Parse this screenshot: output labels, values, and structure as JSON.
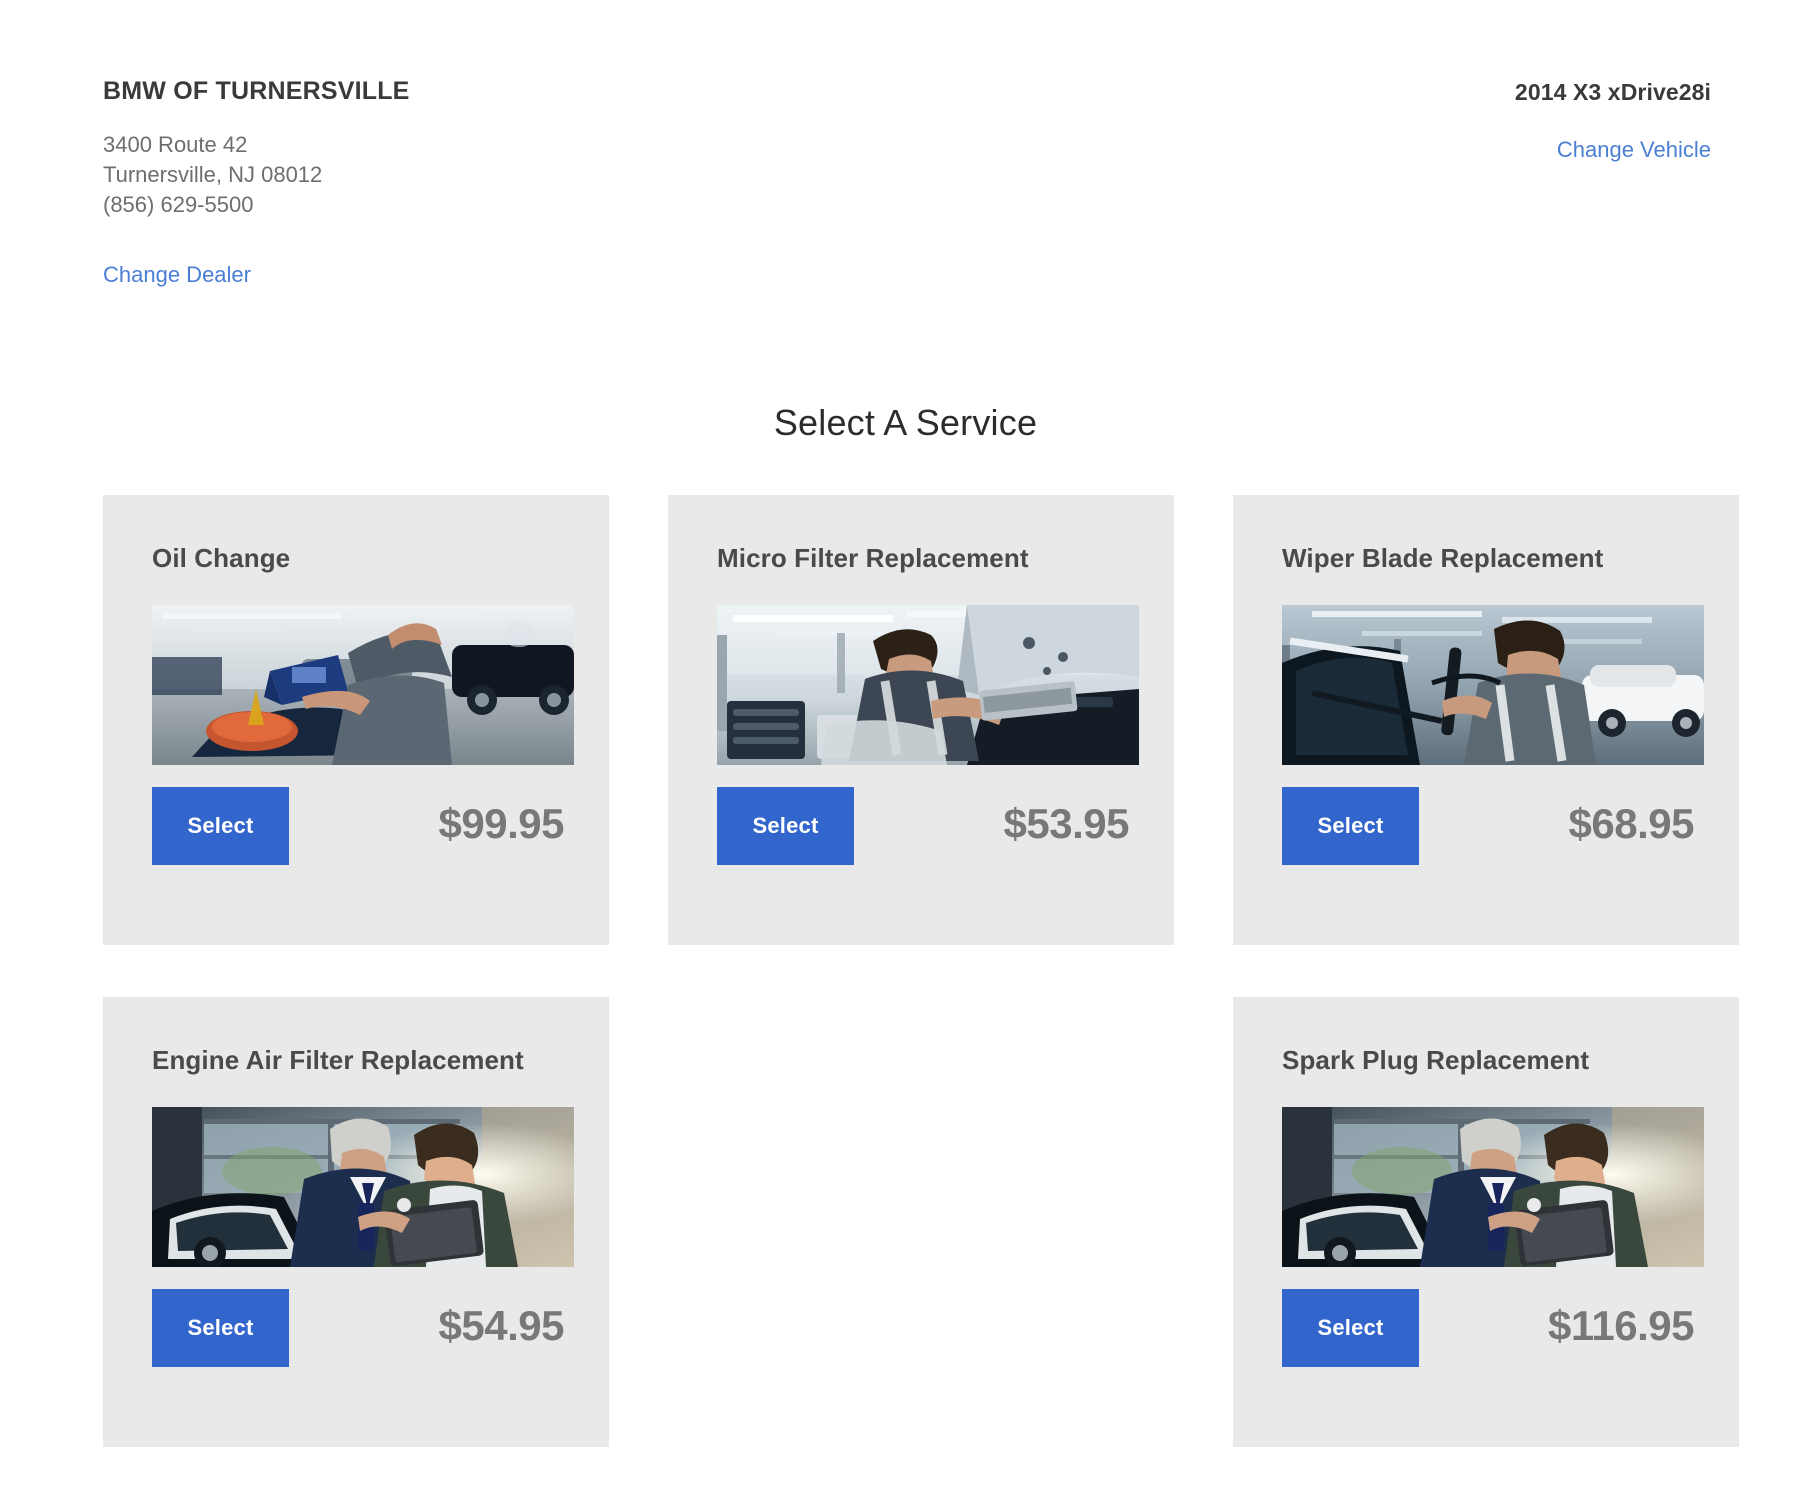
{
  "header": {
    "dealer": {
      "name": "BMW OF TURNERSVILLE",
      "address_line1": "3400 Route 42",
      "address_line2": "Turnersville, NJ 08012",
      "phone": "(856) 629-5500",
      "change_dealer_label": "Change Dealer"
    },
    "vehicle": {
      "name": "2014 X3 xDrive28i",
      "change_vehicle_label": "Change Vehicle"
    }
  },
  "main": {
    "title": "Select A Service",
    "services": [
      {
        "name": "Oil Change",
        "price": "$99.95",
        "select_label": "Select",
        "image_alt": "technician pouring engine oil into funnel",
        "image_id": "oil-change-photo"
      },
      {
        "name": "Micro Filter Replacement",
        "price": "$53.95",
        "select_label": "Select",
        "image_alt": "technician installing cabin micro filter under hood",
        "image_id": "micro-filter-photo"
      },
      {
        "name": "Wiper Blade Replacement",
        "price": "$68.95",
        "select_label": "Select",
        "image_alt": "technician replacing windshield wiper blade",
        "image_id": "wiper-blade-photo"
      },
      {
        "name": "Engine Air Filter Replacement",
        "price": "$54.95",
        "select_label": "Select",
        "image_alt": "service advisor showing tablet to customer in showroom",
        "image_id": "engine-air-filter-photo"
      },
      {
        "name": "Spark Plug Replacement",
        "price": "$116.95",
        "select_label": "Select",
        "image_alt": "service advisor showing tablet to customer in showroom",
        "image_id": "spark-plug-photo"
      }
    ]
  },
  "colors": {
    "accent_blue": "#3366cc",
    "link_blue": "#4a7fd4",
    "card_bg": "#e9e9e9",
    "price_gray": "#787878",
    "heading_gray": "#4a4a4a"
  }
}
